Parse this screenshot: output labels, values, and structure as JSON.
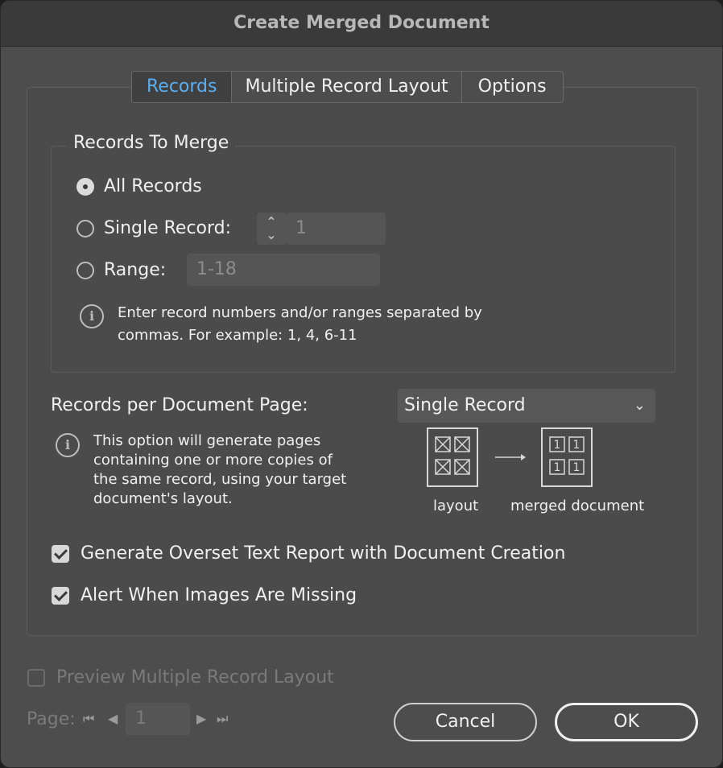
{
  "dialog": {
    "title": "Create Merged Document"
  },
  "tabs": [
    {
      "label": "Records",
      "active": true
    },
    {
      "label": "Multiple Record Layout",
      "active": false
    },
    {
      "label": "Options",
      "active": false
    }
  ],
  "records_to_merge": {
    "title": "Records To Merge",
    "options": {
      "all": {
        "label": "All Records",
        "selected": true
      },
      "single": {
        "label": "Single Record:",
        "value": "1",
        "selected": false
      },
      "range": {
        "label": "Range:",
        "value": "1-18",
        "selected": false
      }
    },
    "note_line1": "Enter record numbers and/or ranges separated by",
    "note_line2": "commas. For example: 1, 4, 6-11"
  },
  "records_per_page": {
    "label": "Records per Document Page:",
    "selected": "Single Record",
    "note_lines": [
      "This option will generate pages",
      "containing one or more copies of",
      "the same record, using your target",
      "document's layout."
    ],
    "diagram": {
      "left_caption": "layout",
      "right_caption": "merged document",
      "cell_label": "1"
    }
  },
  "checkboxes": {
    "overset": {
      "label": "Generate Overset Text Report with Document Creation",
      "checked": true
    },
    "images": {
      "label": "Alert When Images Are Missing",
      "checked": true
    },
    "preview": {
      "label": "Preview Multiple Record Layout",
      "checked": false,
      "disabled": true
    }
  },
  "pager": {
    "label": "Page:",
    "value": "1"
  },
  "buttons": {
    "cancel": "Cancel",
    "ok": "OK"
  },
  "colors": {
    "accent": "#5aaeef",
    "dialog_bg": "#4d4d4d",
    "titlebar_bg": "#3a3a3a"
  }
}
